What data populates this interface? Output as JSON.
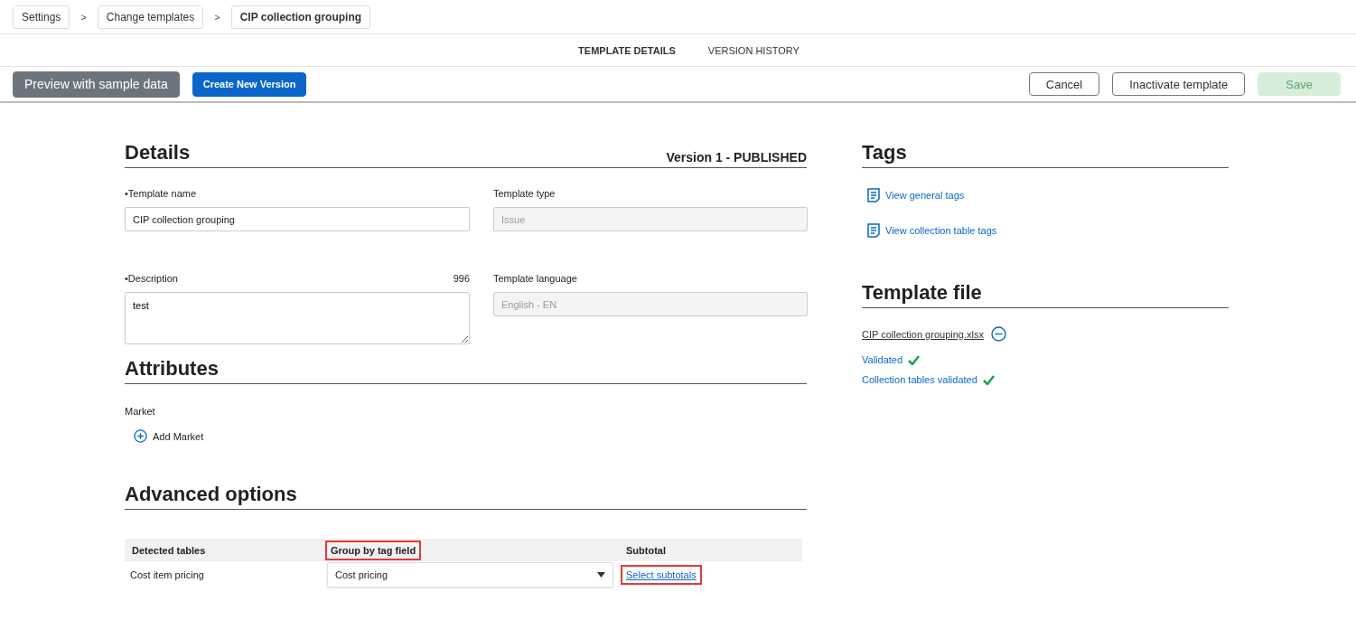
{
  "breadcrumbs": [
    {
      "label": "Settings",
      "current": false
    },
    {
      "label": "Change templates",
      "current": false
    },
    {
      "label": "CIP collection grouping",
      "current": true
    }
  ],
  "breadcrumb_separator": ">",
  "tabs": [
    {
      "label": "TEMPLATE DETAILS",
      "selected": true
    },
    {
      "label": "VERSION HISTORY",
      "selected": false
    }
  ],
  "toolbar": {
    "left": [
      {
        "label": "Preview with sample data",
        "kind": "secondary",
        "disabled": false
      },
      {
        "label": "Create New Version",
        "kind": "primary",
        "disabled": false
      }
    ],
    "right": [
      {
        "label": "Cancel",
        "kind": "outline",
        "disabled": false
      },
      {
        "label": "Inactivate template",
        "kind": "outline",
        "disabled": false
      },
      {
        "label": "Save",
        "kind": "success",
        "disabled": true
      }
    ]
  },
  "details": {
    "title": "Details",
    "version": "Version 1 - PUBLISHED",
    "fields": [
      {
        "label": "•Template name",
        "value": "CIP collection grouping",
        "disabled": false,
        "kind": "input"
      },
      {
        "label": "Template type",
        "value": "Issue",
        "disabled": true,
        "kind": "input"
      },
      {
        "label": "•Description",
        "counter": "996",
        "value": "test",
        "disabled": false,
        "kind": "textarea"
      },
      {
        "label": "Template language",
        "value": "English - EN",
        "disabled": true,
        "kind": "input"
      }
    ]
  },
  "attributes": {
    "title": "Attributes",
    "label": "Market",
    "add_action": "Add Market"
  },
  "advanced": {
    "title": "Advanced options",
    "columns": [
      {
        "label": "Detected tables",
        "highlighted": false
      },
      {
        "label": "Group by tag field",
        "highlighted": true
      },
      {
        "label": "Subtotal",
        "highlighted": false
      }
    ],
    "rows": [
      {
        "table": "Cost item pricing",
        "group_by": "Cost pricing",
        "subtotal_link": "Select subtotals",
        "subtotal_highlighted": true
      }
    ]
  },
  "tags": {
    "title": "Tags",
    "links": [
      "View general tags",
      "View collection table tags"
    ]
  },
  "template_file": {
    "title": "Template file",
    "file_name": "CIP collection grouping.xlsx",
    "statuses": [
      {
        "label": "Validated",
        "ok": true
      },
      {
        "label": "Collection tables validated",
        "ok": true
      }
    ]
  }
}
